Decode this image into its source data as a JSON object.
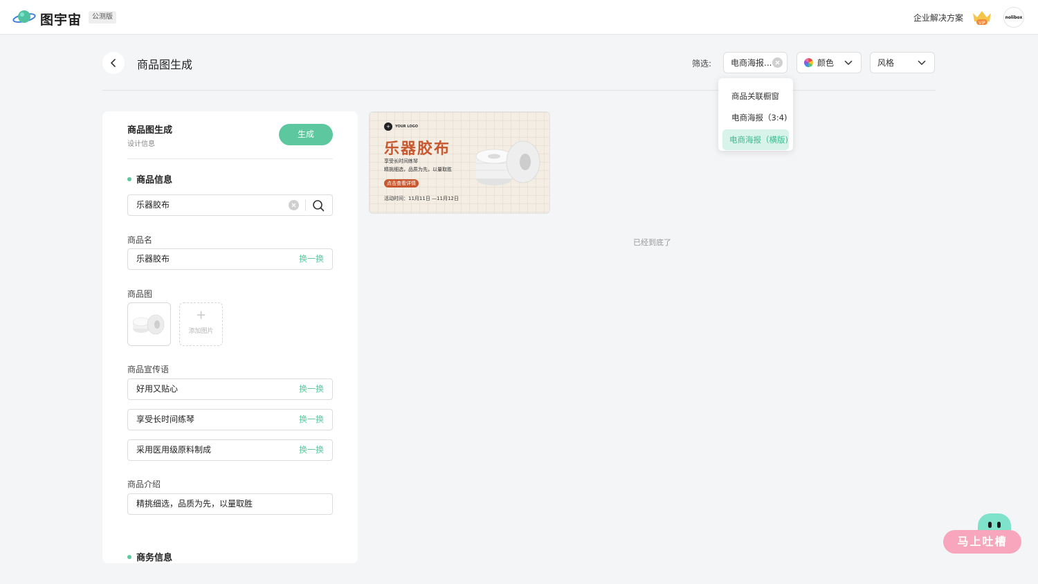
{
  "app": {
    "brand": "图宇宙",
    "badge": "公测版",
    "enterprise_link": "企业解决方案",
    "vip_label": "VIP",
    "account_label": "nolibox"
  },
  "header": {
    "title": "商品图生成",
    "filter_label": "筛选:",
    "filter_category": "电商海报...",
    "filter_color": "颜色",
    "filter_style": "风格"
  },
  "dropdown": {
    "items": [
      {
        "label": "商品关联橱窗",
        "selected": false
      },
      {
        "label": "电商海报（3:4)",
        "selected": false
      },
      {
        "label": "电商海报（横版)",
        "selected": true
      }
    ]
  },
  "panel": {
    "title": "商品图生成",
    "subtitle": "设计信息",
    "generate_label": "生成",
    "product_section": "商品信息",
    "search_value": "乐器胶布",
    "name_label": "商品名",
    "name_value": "乐器胶布",
    "swap_label": "换一换",
    "image_label": "商品图",
    "add_image_label": "添加图片",
    "slogan_label": "商品宣传语",
    "slogans": [
      "好用又贴心",
      "享受长时间练琴",
      "采用医用级原料制成"
    ],
    "intro_label": "商品介绍",
    "intro_value": "精挑细选，品质为先，以量取胜",
    "business_section": "商务信息"
  },
  "poster": {
    "logo_text": "YOUR LOGO",
    "headline": "乐器胶布",
    "line1": "享受长时间练琴",
    "line2": "精挑细选，品质为先，以量取胜",
    "cta": "点击查看详情",
    "date": "活动时间：11月11日 —11月12日"
  },
  "end_text": "已经到底了",
  "feedback_label": "马上吐槽",
  "colors": {
    "accent": "#5dc8a0",
    "poster_accent": "#c8582f",
    "feedback_pink": "#f7a6be",
    "feedback_head": "#7fe3cc"
  }
}
